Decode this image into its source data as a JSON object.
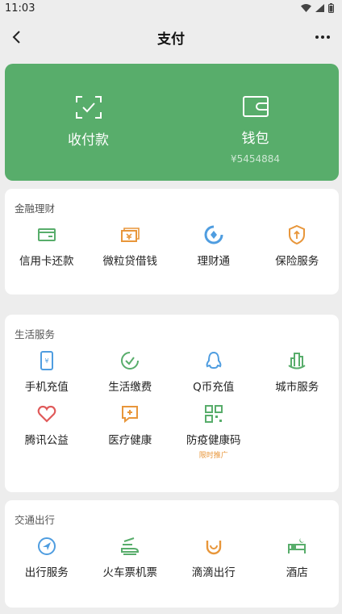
{
  "status": {
    "time": "11:03"
  },
  "nav": {
    "title": "支付"
  },
  "hero": {
    "collect": {
      "label": "收付款"
    },
    "wallet": {
      "label": "钱包",
      "balance": "¥5454884"
    }
  },
  "sections": [
    {
      "title": "金融理财",
      "items": [
        {
          "label": "信用卡还款",
          "icon": "credit-card-icon"
        },
        {
          "label": "微粒贷借钱",
          "icon": "loan-icon"
        },
        {
          "label": "理财通",
          "icon": "wealth-icon"
        },
        {
          "label": "保险服务",
          "icon": "insurance-icon"
        }
      ]
    },
    {
      "title": "生活服务",
      "items": [
        {
          "label": "手机充值",
          "icon": "phone-topup-icon"
        },
        {
          "label": "生活缴费",
          "icon": "bill-payment-icon"
        },
        {
          "label": "Q币充值",
          "icon": "qq-coin-icon"
        },
        {
          "label": "城市服务",
          "icon": "city-service-icon"
        },
        {
          "label": "腾讯公益",
          "icon": "charity-icon"
        },
        {
          "label": "医疗健康",
          "icon": "medical-icon"
        },
        {
          "label": "防疫健康码",
          "icon": "health-code-icon",
          "tag": "限时推广"
        }
      ]
    },
    {
      "title": "交通出行",
      "items": [
        {
          "label": "出行服务",
          "icon": "travel-icon"
        },
        {
          "label": "火车票机票",
          "icon": "train-ticket-icon"
        },
        {
          "label": "滴滴出行",
          "icon": "didi-icon"
        },
        {
          "label": "酒店",
          "icon": "hotel-icon"
        }
      ]
    }
  ],
  "colors": {
    "green": "#58ad6b",
    "orange": "#e8963a",
    "blue": "#4f9de0",
    "red": "#e05a5a"
  }
}
